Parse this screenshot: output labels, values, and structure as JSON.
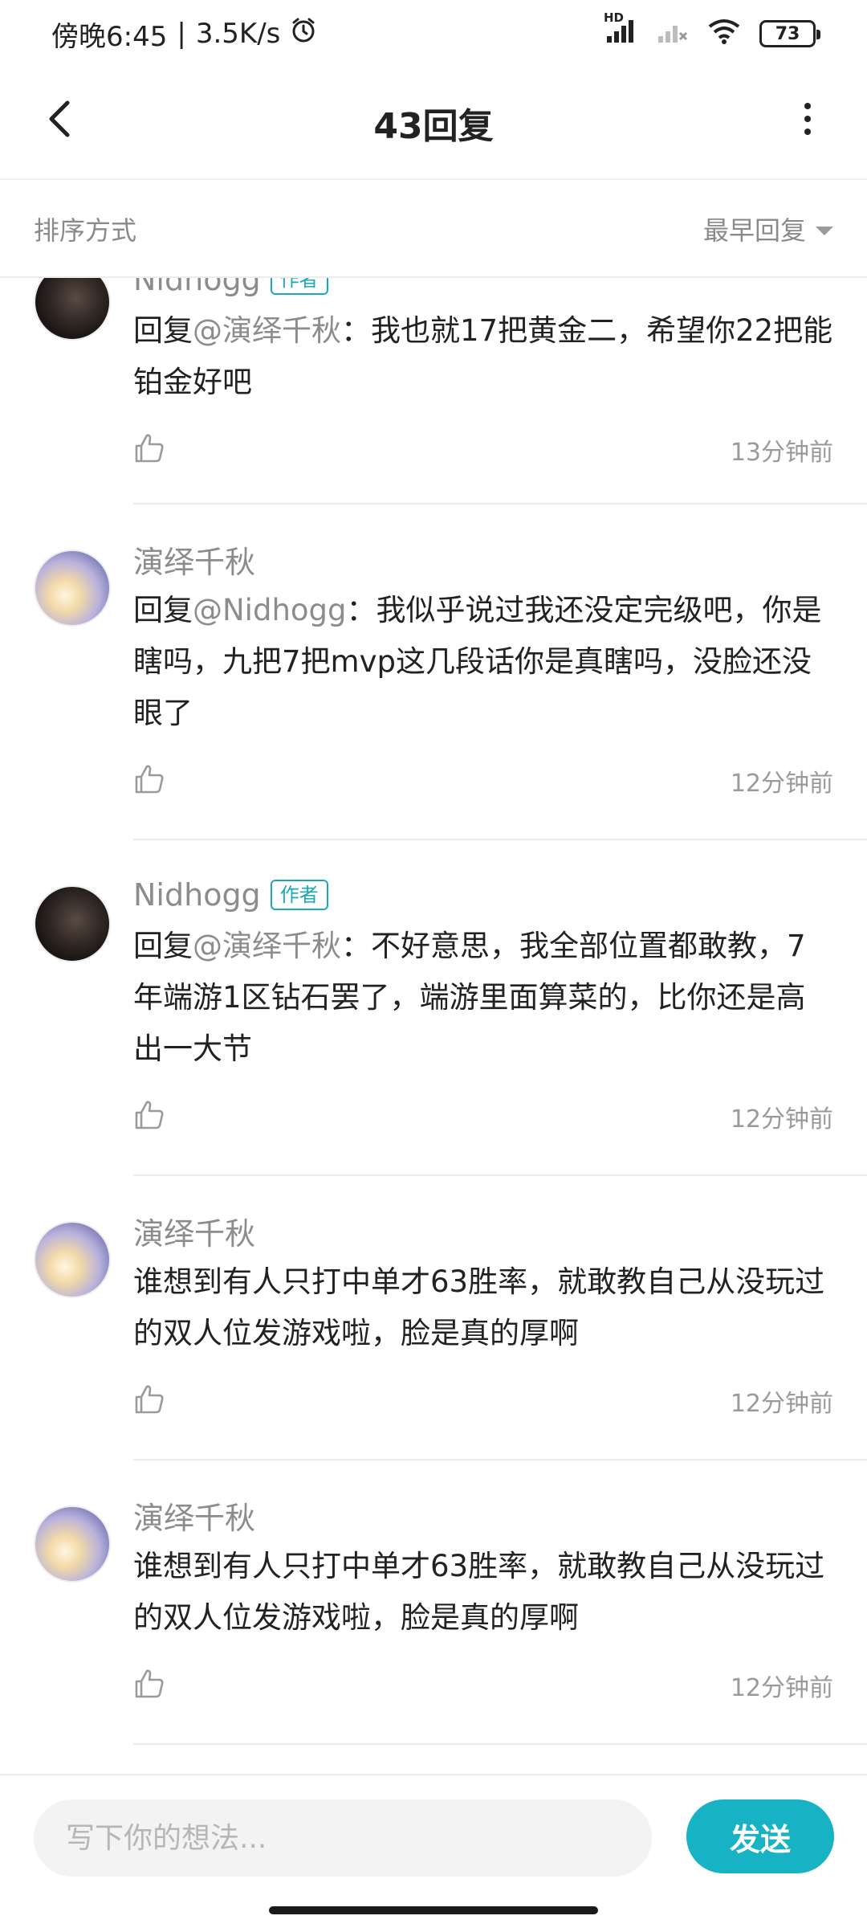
{
  "status_bar": {
    "time": "傍晚6:45",
    "speed": "3.5K/s",
    "battery": "73",
    "network_badge": "HD",
    "icons": [
      "alarm-icon",
      "signal-icon",
      "signal-off-icon",
      "wifi-icon",
      "battery-icon"
    ]
  },
  "header": {
    "title": "43回复",
    "back_icon": "chevron-left-icon",
    "more_icon": "more-vertical-icon"
  },
  "sort": {
    "label": "排序方式",
    "selected": "最早回复"
  },
  "comments": [
    {
      "author": "Nidhogg",
      "author_tag": "作者",
      "avatar": "dark",
      "reply_prefix": "回复",
      "mention": "@演绎千秋",
      "text": "：我也就17把黄金二，希望你22把能铂金好吧",
      "time": "13分钟前"
    },
    {
      "author": "演绎千秋",
      "author_tag": "",
      "avatar": "light",
      "reply_prefix": "回复",
      "mention": "@Nidhogg",
      "text": "：我似乎说过我还没定完级吧，你是瞎吗，九把7把mvp这几段话你是真瞎吗，没脸还没眼了",
      "time": "12分钟前"
    },
    {
      "author": "Nidhogg",
      "author_tag": "作者",
      "avatar": "dark",
      "reply_prefix": "回复",
      "mention": "@演绎千秋",
      "text": "：不好意思，我全部位置都敢教，7年端游1区钻石罢了，端游里面算菜的，比你还是高出一大节",
      "time": "12分钟前"
    },
    {
      "author": "演绎千秋",
      "author_tag": "",
      "avatar": "light",
      "reply_prefix": "",
      "mention": "",
      "text": "谁想到有人只打中单才63胜率，就敢教自己从没玩过的双人位发游戏啦，脸是真的厚啊",
      "time": "12分钟前"
    },
    {
      "author": "演绎千秋",
      "author_tag": "",
      "avatar": "light",
      "reply_prefix": "",
      "mention": "",
      "text": "谁想到有人只打中单才63胜率，就敢教自己从没玩过的双人位发游戏啦，脸是真的厚啊",
      "time": "12分钟前"
    }
  ],
  "input": {
    "placeholder": "写下你的想法...",
    "value": "",
    "send_label": "发送"
  }
}
